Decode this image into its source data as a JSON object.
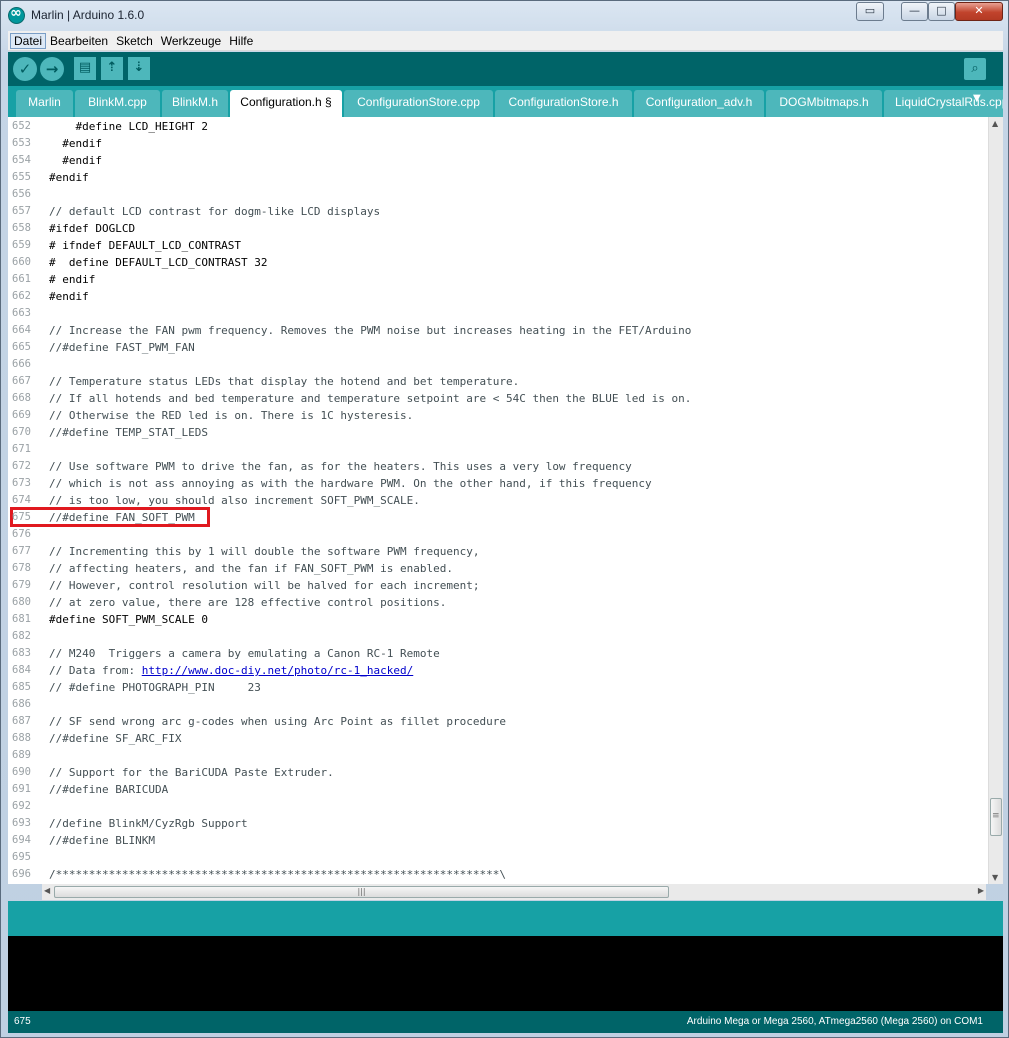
{
  "window": {
    "title": "Marlin | Arduino 1.6.0",
    "app_icon": "arduino-icon",
    "controls": {
      "extra": "▭",
      "minimize": "—",
      "maximize": "□",
      "close": "✕"
    }
  },
  "menu": [
    "Datei",
    "Bearbeiten",
    "Sketch",
    "Werkzeuge",
    "Hilfe"
  ],
  "toolbar": {
    "verify_icon": "✓",
    "upload_icon": "→",
    "new_icon": "▤",
    "open_icon": "⇡",
    "save_icon": "⇣",
    "serial_icon": "⌕"
  },
  "tabs": [
    {
      "label": "Marlin"
    },
    {
      "label": "BlinkM.cpp"
    },
    {
      "label": "BlinkM.h"
    },
    {
      "label": "Configuration.h §"
    },
    {
      "label": "ConfigurationStore.cpp"
    },
    {
      "label": "ConfigurationStore.h"
    },
    {
      "label": "Configuration_adv.h"
    },
    {
      "label": "DOGMbitmaps.h"
    },
    {
      "label": "LiquidCrystalRus.cpp"
    }
  ],
  "tab_menu_icon": "▼",
  "editor": {
    "lines": [
      {
        "n": "652",
        "t": "    #define LCD_HEIGHT 2"
      },
      {
        "n": "653",
        "t": "  #endif"
      },
      {
        "n": "654",
        "t": "  #endif"
      },
      {
        "n": "655",
        "t": "#endif"
      },
      {
        "n": "656",
        "t": ""
      },
      {
        "n": "657",
        "t": "// default LCD contrast for dogm-like LCD displays"
      },
      {
        "n": "658",
        "t": "#ifdef DOGLCD"
      },
      {
        "n": "659",
        "t": "# ifndef DEFAULT_LCD_CONTRAST"
      },
      {
        "n": "660",
        "t": "#  define DEFAULT_LCD_CONTRAST 32"
      },
      {
        "n": "661",
        "t": "# endif"
      },
      {
        "n": "662",
        "t": "#endif"
      },
      {
        "n": "663",
        "t": ""
      },
      {
        "n": "664",
        "t": "// Increase the FAN pwm frequency. Removes the PWM noise but increases heating in the FET/Arduino"
      },
      {
        "n": "665",
        "t": "//#define FAST_PWM_FAN"
      },
      {
        "n": "666",
        "t": ""
      },
      {
        "n": "667",
        "t": "// Temperature status LEDs that display the hotend and bet temperature."
      },
      {
        "n": "668",
        "t": "// If all hotends and bed temperature and temperature setpoint are < 54C then the BLUE led is on."
      },
      {
        "n": "669",
        "t": "// Otherwise the RED led is on. There is 1C hysteresis."
      },
      {
        "n": "670",
        "t": "//#define TEMP_STAT_LEDS"
      },
      {
        "n": "671",
        "t": ""
      },
      {
        "n": "672",
        "t": "// Use software PWM to drive the fan, as for the heaters. This uses a very low frequency"
      },
      {
        "n": "673",
        "t": "// which is not ass annoying as with the hardware PWM. On the other hand, if this frequency"
      },
      {
        "n": "674",
        "t": "// is too low, you should also increment SOFT_PWM_SCALE."
      },
      {
        "n": "675",
        "t": "//#define FAN_SOFT_PWM"
      },
      {
        "n": "676",
        "t": ""
      },
      {
        "n": "677",
        "t": "// Incrementing this by 1 will double the software PWM frequency,"
      },
      {
        "n": "678",
        "t": "// affecting heaters, and the fan if FAN_SOFT_PWM is enabled."
      },
      {
        "n": "679",
        "t": "// However, control resolution will be halved for each increment;"
      },
      {
        "n": "680",
        "t": "// at zero value, there are 128 effective control positions."
      },
      {
        "n": "681",
        "t": "#define SOFT_PWM_SCALE 0"
      },
      {
        "n": "682",
        "t": ""
      },
      {
        "n": "683",
        "t": "// M240  Triggers a camera by emulating a Canon RC-1 Remote"
      },
      {
        "n": "684",
        "t": "// Data from: ",
        "link": "http://www.doc-diy.net/photo/rc-1_hacked/"
      },
      {
        "n": "685",
        "t": "// #define PHOTOGRAPH_PIN     23"
      },
      {
        "n": "686",
        "t": ""
      },
      {
        "n": "687",
        "t": "// SF send wrong arc g-codes when using Arc Point as fillet procedure"
      },
      {
        "n": "688",
        "t": "//#define SF_ARC_FIX"
      },
      {
        "n": "689",
        "t": ""
      },
      {
        "n": "690",
        "t": "// Support for the BariCUDA Paste Extruder."
      },
      {
        "n": "691",
        "t": "//#define BARICUDA"
      },
      {
        "n": "692",
        "t": ""
      },
      {
        "n": "693",
        "t": "//define BlinkM/CyzRgb Support"
      },
      {
        "n": "694",
        "t": "//#define BLINKM"
      },
      {
        "n": "695",
        "t": ""
      },
      {
        "n": "696",
        "t": "/*******************************************************************\\"
      }
    ]
  },
  "scrollbars": {
    "h_thumb_grip": "|||",
    "up": "▲",
    "down": "▼",
    "left": "◀",
    "right": "▶",
    "v_thumb_grip": "≡"
  },
  "status": {
    "line": "675",
    "board": "Arduino Mega or Mega 2560, ATmega2560 (Mega 2560) on COM1"
  },
  "colors": {
    "toolbar": "#006468",
    "tabs": "#17a1a5",
    "highlight": "#e0191f"
  }
}
